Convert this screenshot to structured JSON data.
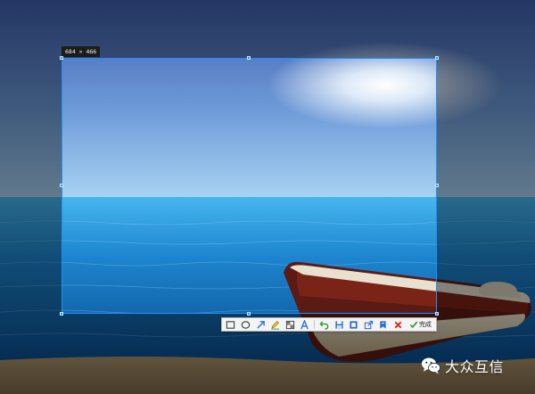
{
  "selection": {
    "size_label": "684 × 466"
  },
  "toolbar": {
    "tools": [
      {
        "name": "rectangle-tool",
        "icon": "rectangle-icon"
      },
      {
        "name": "ellipse-tool",
        "icon": "ellipse-icon"
      },
      {
        "name": "arrow-tool",
        "icon": "arrow-icon"
      },
      {
        "name": "pen-tool",
        "icon": "pen-icon"
      },
      {
        "name": "mosaic-tool",
        "icon": "mosaic-icon"
      },
      {
        "name": "text-tool",
        "icon": "text-icon"
      },
      {
        "name": "undo-tool",
        "icon": "undo-icon"
      },
      {
        "name": "save-tool",
        "icon": "save-icon"
      },
      {
        "name": "pin-tool",
        "icon": "pin-icon"
      },
      {
        "name": "share-tool",
        "icon": "share-icon"
      },
      {
        "name": "bookmark-tool",
        "icon": "bookmark-icon"
      },
      {
        "name": "cancel-tool",
        "icon": "close-icon"
      }
    ],
    "done_label": "完成",
    "colors": {
      "blue": "#2b6fd6",
      "green": "#2f9a3a",
      "red": "#e0261b",
      "dark": "#3a3a3a"
    }
  },
  "watermark": {
    "text": "大众互信",
    "icon": "wechat-icon"
  }
}
